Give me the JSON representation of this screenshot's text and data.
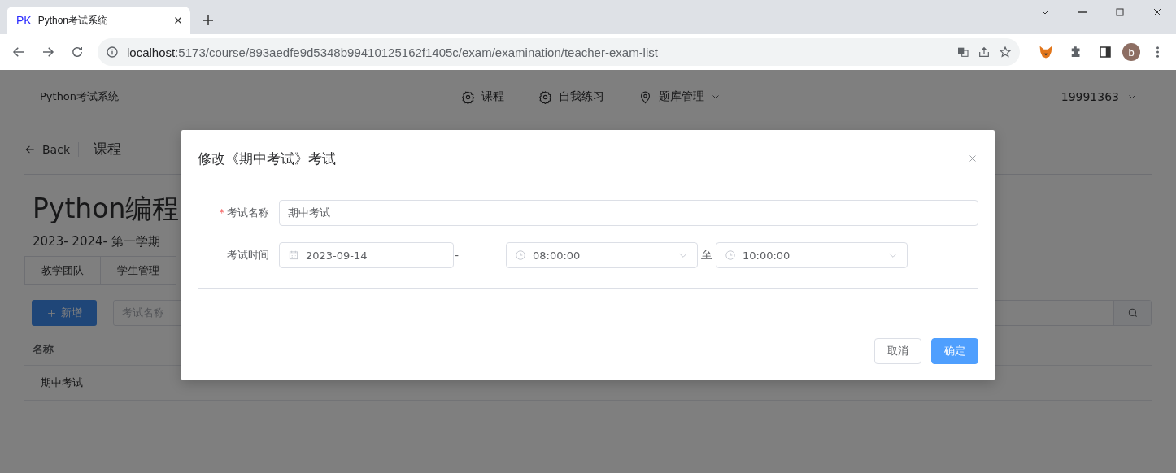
{
  "browser": {
    "tab_title": "Python考试系统",
    "favicon": "PK",
    "url_host": "localhost",
    "url_path": ":5173/course/893aedfe9d5348b99410125162f1405c/exam/examination/teacher-exam-list",
    "profile": "b"
  },
  "header": {
    "brand": "Python考试系统",
    "nav": [
      {
        "label": "课程",
        "dropdown": false
      },
      {
        "label": "自我练习",
        "dropdown": false
      },
      {
        "label": "题库管理",
        "dropdown": true
      }
    ],
    "user": "19991363"
  },
  "breadcrumb": {
    "back": "Back",
    "current": "课程"
  },
  "course": {
    "title": "Python编程",
    "term": "2023- 2024- 第一学期"
  },
  "tabs": [
    {
      "label": "教学团队",
      "selected": false
    },
    {
      "label": "学生管理",
      "selected": false
    }
  ],
  "toolbar": {
    "add_button": "新增",
    "search_placeholder": "考试名称"
  },
  "table": {
    "columns": [
      "名称"
    ],
    "rows": [
      [
        "期中考试"
      ]
    ]
  },
  "dialog": {
    "title": "修改《期中考试》考试",
    "fields": [
      {
        "kind": "text",
        "required_mark": "*",
        "label": "考试名称",
        "value": "期中考试"
      },
      {
        "kind": "datetime-range",
        "label": "考试时间",
        "date": "2023-09-14",
        "separator": "-",
        "start": "08:00:00",
        "to": "至",
        "end": "10:00:00"
      }
    ],
    "buttons": [
      {
        "label": "取消",
        "primary": false
      },
      {
        "label": "确定",
        "primary": true
      }
    ]
  }
}
